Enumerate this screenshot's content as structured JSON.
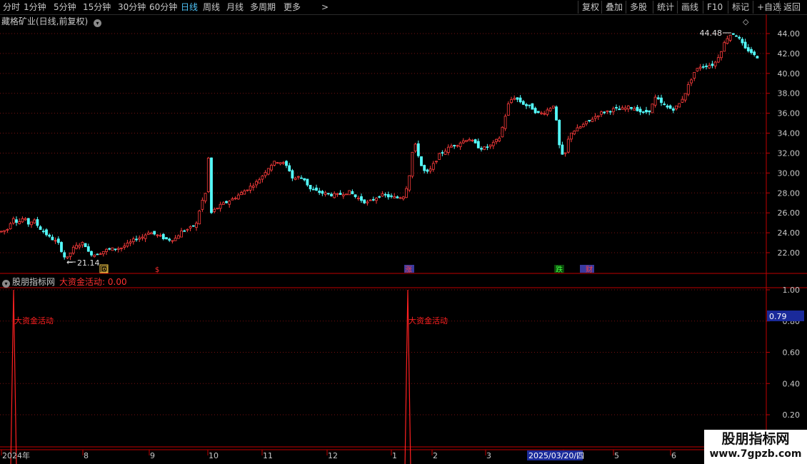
{
  "toolbar": {
    "periods": [
      "分时",
      "1分钟",
      "5分钟",
      "15分钟",
      "30分钟",
      "60分钟",
      "日线",
      "周线",
      "月线",
      "多周期",
      "更多"
    ],
    "active_period": "日线",
    "more_arrow": ">",
    "right_buttons": [
      "复权",
      "叠加",
      "多股",
      "统计",
      "画线",
      "F10",
      "标记",
      "+自选",
      "返回"
    ]
  },
  "main_chart": {
    "title": "藏格矿业(日线,前复权)",
    "high_label": "44.48",
    "low_label": "21.14",
    "price_axis": [
      "44.00",
      "42.00",
      "40.00",
      "38.00",
      "36.00",
      "34.00",
      "32.00",
      "30.00",
      "28.00",
      "26.00",
      "24.00",
      "22.00"
    ],
    "markers": [
      {
        "label": "回",
        "color": "#ffd24a"
      },
      {
        "label": "$",
        "color": "#ff3030"
      },
      {
        "label": "涨",
        "color": "#ff4040"
      },
      {
        "label": "跌",
        "color": "#40ff40"
      },
      {
        "label": "财",
        "color": "#ff4040"
      }
    ]
  },
  "indicator": {
    "name": "股朋指标网",
    "line_label": "大资金活动: 0.00",
    "annotation": "大资金活动",
    "axis": [
      "1.00",
      "0.80",
      "0.60",
      "0.40",
      "0.20"
    ],
    "cursor_value": "0.79"
  },
  "date_axis": {
    "labels": [
      "2024年",
      "8",
      "9",
      "10",
      "11",
      "12",
      "1",
      "2",
      "3",
      "4",
      "5",
      "6"
    ],
    "highlight": "2025/03/20/四"
  },
  "watermark": {
    "line1": "股朋指标网",
    "line2": "www.7gpzb.com"
  },
  "colors": {
    "up": "#ff3c3c",
    "down": "#54ffff",
    "grid": "#7a1010",
    "axis": "#c00000",
    "active": "#4fc3f7"
  },
  "chart_data": {
    "type": "candlestick",
    "y_range": [
      20.5,
      45.5
    ],
    "price_path": [
      [
        0,
        24.1
      ],
      [
        10,
        24.3
      ],
      [
        18,
        25.6
      ],
      [
        25,
        25.0
      ],
      [
        33,
        25.5
      ],
      [
        40,
        24.9
      ],
      [
        47,
        25.3
      ],
      [
        55,
        24.5
      ],
      [
        62,
        24.1
      ],
      [
        68,
        23.6
      ],
      [
        75,
        23.3
      ],
      [
        82,
        22.9
      ],
      [
        90,
        21.6
      ],
      [
        96,
        21.4
      ],
      [
        100,
        22.3
      ],
      [
        110,
        22.8
      ],
      [
        118,
        23.0
      ],
      [
        124,
        22.0
      ],
      [
        132,
        21.8
      ],
      [
        140,
        22.0
      ],
      [
        150,
        22.3
      ],
      [
        160,
        22.4
      ],
      [
        170,
        22.5
      ],
      [
        180,
        22.9
      ],
      [
        190,
        23.4
      ],
      [
        200,
        23.6
      ],
      [
        208,
        24.1
      ],
      [
        215,
        23.9
      ],
      [
        225,
        23.6
      ],
      [
        235,
        23.3
      ],
      [
        245,
        23.4
      ],
      [
        255,
        24.2
      ],
      [
        265,
        24.4
      ],
      [
        275,
        24.9
      ],
      [
        280,
        26.5
      ],
      [
        286,
        27.8
      ],
      [
        292,
        28.3
      ],
      [
        296,
        26.0
      ],
      [
        302,
        26.4
      ],
      [
        310,
        26.8
      ],
      [
        318,
        27.1
      ],
      [
        326,
        27.4
      ],
      [
        334,
        27.8
      ],
      [
        342,
        28.2
      ],
      [
        350,
        28.6
      ],
      [
        358,
        29.0
      ],
      [
        366,
        29.6
      ],
      [
        374,
        30.4
      ],
      [
        382,
        31.0
      ],
      [
        390,
        31.2
      ],
      [
        398,
        30.9
      ],
      [
        404,
        30.5
      ],
      [
        410,
        29.4
      ],
      [
        418,
        29.6
      ],
      [
        426,
        29.4
      ],
      [
        434,
        28.4
      ],
      [
        442,
        28.2
      ],
      [
        450,
        28.0
      ],
      [
        458,
        27.9
      ],
      [
        466,
        27.8
      ],
      [
        474,
        27.8
      ],
      [
        482,
        28.0
      ],
      [
        490,
        28.1
      ],
      [
        498,
        27.6
      ],
      [
        506,
        27.3
      ],
      [
        514,
        27.0
      ],
      [
        522,
        27.3
      ],
      [
        530,
        27.7
      ],
      [
        538,
        27.8
      ],
      [
        546,
        27.6
      ],
      [
        556,
        27.5
      ],
      [
        565,
        27.7
      ],
      [
        572,
        29.2
      ],
      [
        578,
        32.4
      ],
      [
        583,
        32.9
      ],
      [
        588,
        31.0
      ],
      [
        594,
        30.2
      ],
      [
        600,
        30.0
      ],
      [
        608,
        31.0
      ],
      [
        616,
        31.9
      ],
      [
        624,
        32.3
      ],
      [
        632,
        32.7
      ],
      [
        640,
        32.9
      ],
      [
        648,
        33.2
      ],
      [
        656,
        33.5
      ],
      [
        664,
        33.0
      ],
      [
        672,
        32.5
      ],
      [
        680,
        32.5
      ],
      [
        690,
        32.9
      ],
      [
        700,
        33.6
      ],
      [
        707,
        35.6
      ],
      [
        713,
        37.2
      ],
      [
        720,
        37.6
      ],
      [
        728,
        37.2
      ],
      [
        736,
        36.8
      ],
      [
        744,
        36.6
      ],
      [
        752,
        36.0
      ],
      [
        760,
        36.0
      ],
      [
        768,
        36.4
      ],
      [
        776,
        36.9
      ],
      [
        784,
        32.3
      ],
      [
        790,
        31.3
      ],
      [
        794,
        33.0
      ],
      [
        800,
        34.1
      ],
      [
        808,
        34.4
      ],
      [
        816,
        34.8
      ],
      [
        824,
        35.2
      ],
      [
        832,
        35.6
      ],
      [
        840,
        36.0
      ],
      [
        850,
        36.2
      ],
      [
        860,
        36.4
      ],
      [
        870,
        36.4
      ],
      [
        880,
        36.6
      ],
      [
        890,
        36.5
      ],
      [
        900,
        36.0
      ],
      [
        910,
        36.3
      ],
      [
        918,
        37.6
      ],
      [
        926,
        37.0
      ],
      [
        934,
        36.6
      ],
      [
        942,
        36.4
      ],
      [
        950,
        36.8
      ],
      [
        958,
        37.8
      ],
      [
        965,
        39.0
      ],
      [
        972,
        40.1
      ],
      [
        980,
        40.7
      ],
      [
        990,
        40.8
      ],
      [
        1000,
        40.9
      ],
      [
        1008,
        42.0
      ],
      [
        1014,
        43.0
      ],
      [
        1020,
        43.8
      ],
      [
        1026,
        44.0
      ],
      [
        1032,
        43.8
      ],
      [
        1038,
        43.1
      ],
      [
        1044,
        42.4
      ],
      [
        1050,
        42.3
      ],
      [
        1056,
        41.8
      ],
      [
        1062,
        41.6
      ]
    ]
  },
  "indicator_data": {
    "type": "line",
    "spikes_at_x": [
      19,
      571
    ],
    "spike_value": 1.0,
    "baseline": 0.0
  }
}
